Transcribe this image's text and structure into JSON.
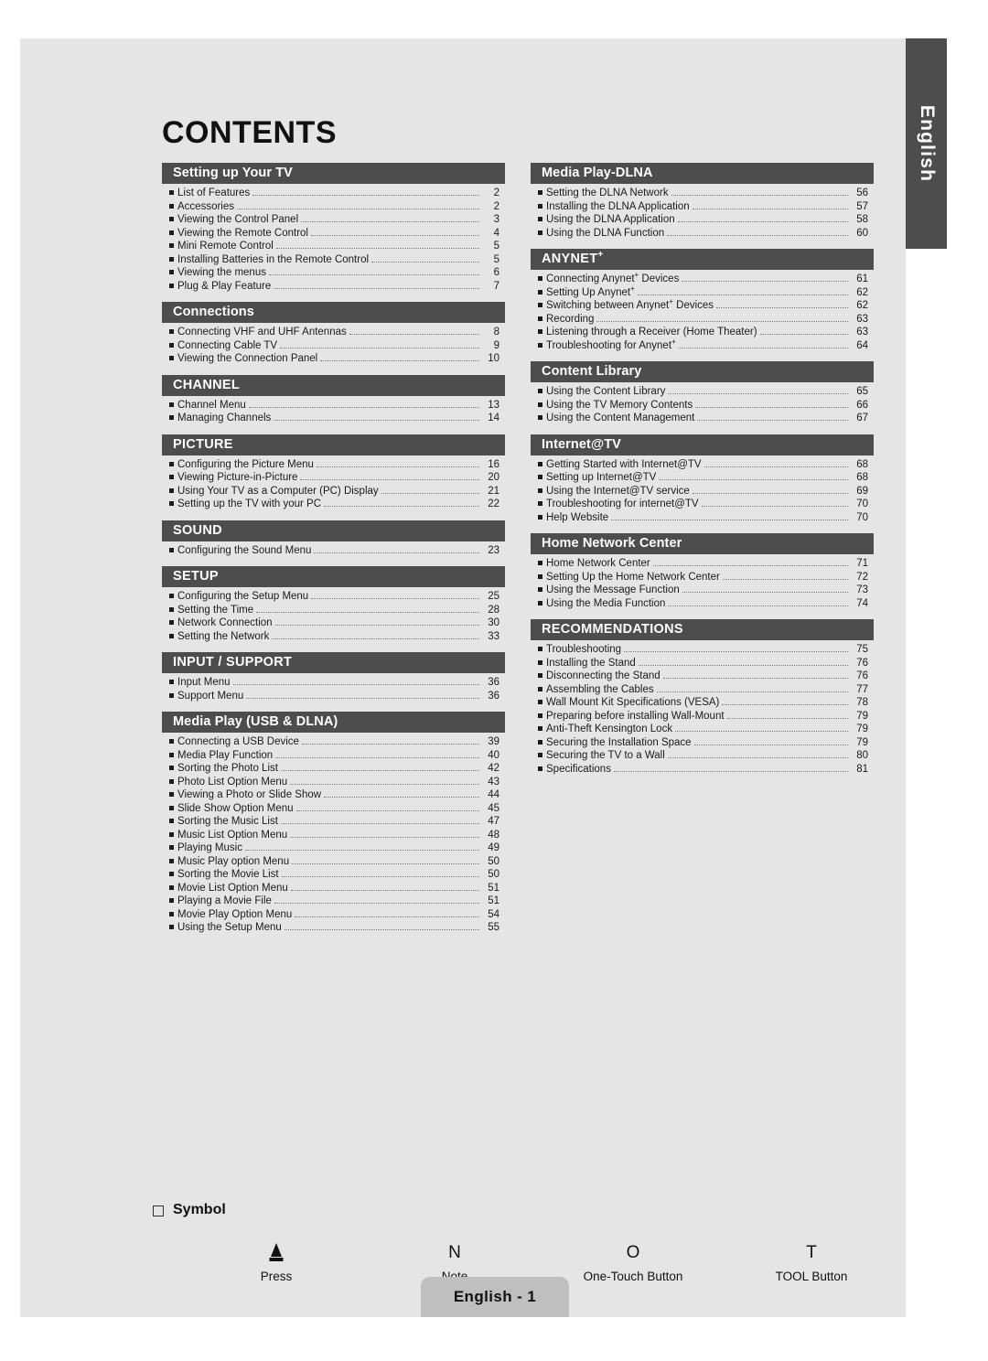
{
  "page_title": "CONTENTS",
  "language_tab": "English",
  "footer": {
    "label": "English - 1"
  },
  "symbol": {
    "heading": "Symbol",
    "items": [
      {
        "glyph": "press-icon",
        "caption": "Press"
      },
      {
        "glyph": "N",
        "caption": "Note"
      },
      {
        "glyph": "O",
        "caption": "One-Touch Button"
      },
      {
        "glyph": "T",
        "caption": "TOOL Button"
      }
    ]
  },
  "colors": {
    "page_background": "#e5e5e5",
    "section_header": "#4d4d4d",
    "section_header_text": "#ffffff",
    "body_text": "#1b1b1b",
    "footer_badge": "#bfbfbf"
  },
  "columns": {
    "left": [
      {
        "title": "Setting up Your TV",
        "style": "title",
        "entries": [
          {
            "label": "List of Features",
            "page": "2"
          },
          {
            "label": "Accessories",
            "page": "2"
          },
          {
            "label": "Viewing the Control Panel",
            "page": "3"
          },
          {
            "label": "Viewing the Remote Control",
            "page": "4"
          },
          {
            "label": "Mini Remote Control",
            "page": "5"
          },
          {
            "label": "Installing Batteries in the Remote Control",
            "page": "5"
          },
          {
            "label": "Viewing the menus",
            "page": "6"
          },
          {
            "label": "Plug & Play Feature",
            "page": "7"
          }
        ]
      },
      {
        "title": "Connections",
        "style": "title",
        "entries": [
          {
            "label": "Connecting VHF and UHF Antennas",
            "page": "8"
          },
          {
            "label": "Connecting Cable TV",
            "page": "9"
          },
          {
            "label": "Viewing the Connection Panel",
            "page": "10"
          }
        ]
      },
      {
        "title": "CHANNEL",
        "style": "caps",
        "entries": [
          {
            "label": "Channel Menu",
            "page": "13"
          },
          {
            "label": "Managing Channels",
            "page": "14"
          }
        ]
      },
      {
        "title": "PICTURE",
        "style": "caps",
        "entries": [
          {
            "label": "Configuring the Picture Menu",
            "page": "16"
          },
          {
            "label": "Viewing Picture-in-Picture",
            "page": "20"
          },
          {
            "label": "Using Your TV as a Computer (PC) Display",
            "page": "21"
          },
          {
            "label": "Setting up the TV with your PC",
            "page": "22"
          }
        ]
      },
      {
        "title": "SOUND",
        "style": "caps",
        "entries": [
          {
            "label": "Configuring the Sound Menu",
            "page": "23"
          }
        ]
      },
      {
        "title": "SETUP",
        "style": "caps",
        "entries": [
          {
            "label": "Configuring the Setup Menu",
            "page": "25"
          },
          {
            "label": "Setting the Time",
            "page": "28"
          },
          {
            "label": "Network Connection",
            "page": "30"
          },
          {
            "label": "Setting the Network",
            "page": "33"
          }
        ]
      },
      {
        "title": "INPUT / SUPPORT",
        "style": "caps",
        "entries": [
          {
            "label": "Input Menu",
            "page": "36"
          },
          {
            "label": "Support Menu",
            "page": "36"
          }
        ]
      },
      {
        "title": "Media Play (USB & DLNA)",
        "style": "title",
        "entries": [
          {
            "label": "Connecting a USB Device",
            "page": "39"
          },
          {
            "label": "Media Play Function",
            "page": "40"
          },
          {
            "label": "Sorting the Photo List",
            "page": "42"
          },
          {
            "label": "Photo List Option Menu",
            "page": "43"
          },
          {
            "label": "Viewing a Photo or Slide Show",
            "page": "44"
          },
          {
            "label": "Slide Show Option Menu",
            "page": "45"
          },
          {
            "label": "Sorting the Music List",
            "page": "47"
          },
          {
            "label": "Music List Option Menu",
            "page": "48"
          },
          {
            "label": "Playing Music",
            "page": "49"
          },
          {
            "label": "Music Play option Menu",
            "page": "50"
          },
          {
            "label": "Sorting the Movie List",
            "page": "50"
          },
          {
            "label": "Movie List Option Menu",
            "page": "51"
          },
          {
            "label": "Playing a Movie File",
            "page": "51"
          },
          {
            "label": "Movie Play Option Menu",
            "page": "54"
          },
          {
            "label": "Using the Setup Menu",
            "page": "55"
          }
        ]
      }
    ],
    "right": [
      {
        "title": "Media Play-DLNA",
        "style": "title",
        "entries": [
          {
            "label": "Setting the DLNA Network",
            "page": "56"
          },
          {
            "label": "Installing the DLNA Application",
            "page": "57"
          },
          {
            "label": "Using the DLNA Application",
            "page": "58"
          },
          {
            "label": "Using the DLNA Function",
            "page": "60"
          }
        ]
      },
      {
        "title": "ANYNET",
        "title_sup": "+",
        "style": "caps",
        "entries": [
          {
            "label": "Connecting Anynet",
            "sup": "+",
            "label_tail": " Devices",
            "page": "61"
          },
          {
            "label": "Setting Up Anynet",
            "sup": "+",
            "label_tail": "",
            "page": "62"
          },
          {
            "label": "Switching between Anynet",
            "sup": "+",
            "label_tail": " Devices",
            "page": "62"
          },
          {
            "label": "Recording",
            "page": "63"
          },
          {
            "label": "Listening through a Receiver (Home Theater)",
            "page": "63"
          },
          {
            "label": "Troubleshooting for Anynet",
            "sup": "+",
            "label_tail": "",
            "page": "64"
          }
        ]
      },
      {
        "title": "Content Library",
        "style": "title",
        "entries": [
          {
            "label": "Using the Content Library",
            "page": "65"
          },
          {
            "label": "Using the TV Memory Contents",
            "page": "66"
          },
          {
            "label": "Using the Content Management",
            "page": "67"
          }
        ]
      },
      {
        "title": "Internet@TV",
        "style": "title",
        "entries": [
          {
            "label": "Getting Started with Internet@TV",
            "page": "68"
          },
          {
            "label": "Setting up Internet@TV",
            "page": "68"
          },
          {
            "label": "Using the Internet@TV service",
            "page": "69"
          },
          {
            "label": "Troubleshooting for internet@TV",
            "page": "70"
          },
          {
            "label": "Help Website",
            "page": "70"
          }
        ]
      },
      {
        "title": "Home Network Center",
        "style": "title",
        "entries": [
          {
            "label": "Home Network Center",
            "page": "71"
          },
          {
            "label": "Setting Up the Home Network Center",
            "page": "72"
          },
          {
            "label": "Using the Message Function",
            "page": "73"
          },
          {
            "label": "Using the Media Function",
            "page": "74"
          }
        ]
      },
      {
        "title": "RECOMMENDATIONS",
        "style": "caps",
        "entries": [
          {
            "label": "Troubleshooting",
            "page": "75"
          },
          {
            "label": "Installing the Stand",
            "page": "76"
          },
          {
            "label": "Disconnecting the Stand",
            "page": "76"
          },
          {
            "label": "Assembling the Cables",
            "page": "77"
          },
          {
            "label": "Wall Mount Kit Specifications (VESA)",
            "page": "78"
          },
          {
            "label": "Preparing before installing Wall-Mount",
            "page": "79"
          },
          {
            "label": "Anti-Theft Kensington Lock",
            "page": "79"
          },
          {
            "label": "Securing the Installation Space",
            "page": "79"
          },
          {
            "label": "Securing the TV to a Wall",
            "page": "80"
          },
          {
            "label": "Specifications",
            "page": "81"
          }
        ]
      }
    ]
  }
}
